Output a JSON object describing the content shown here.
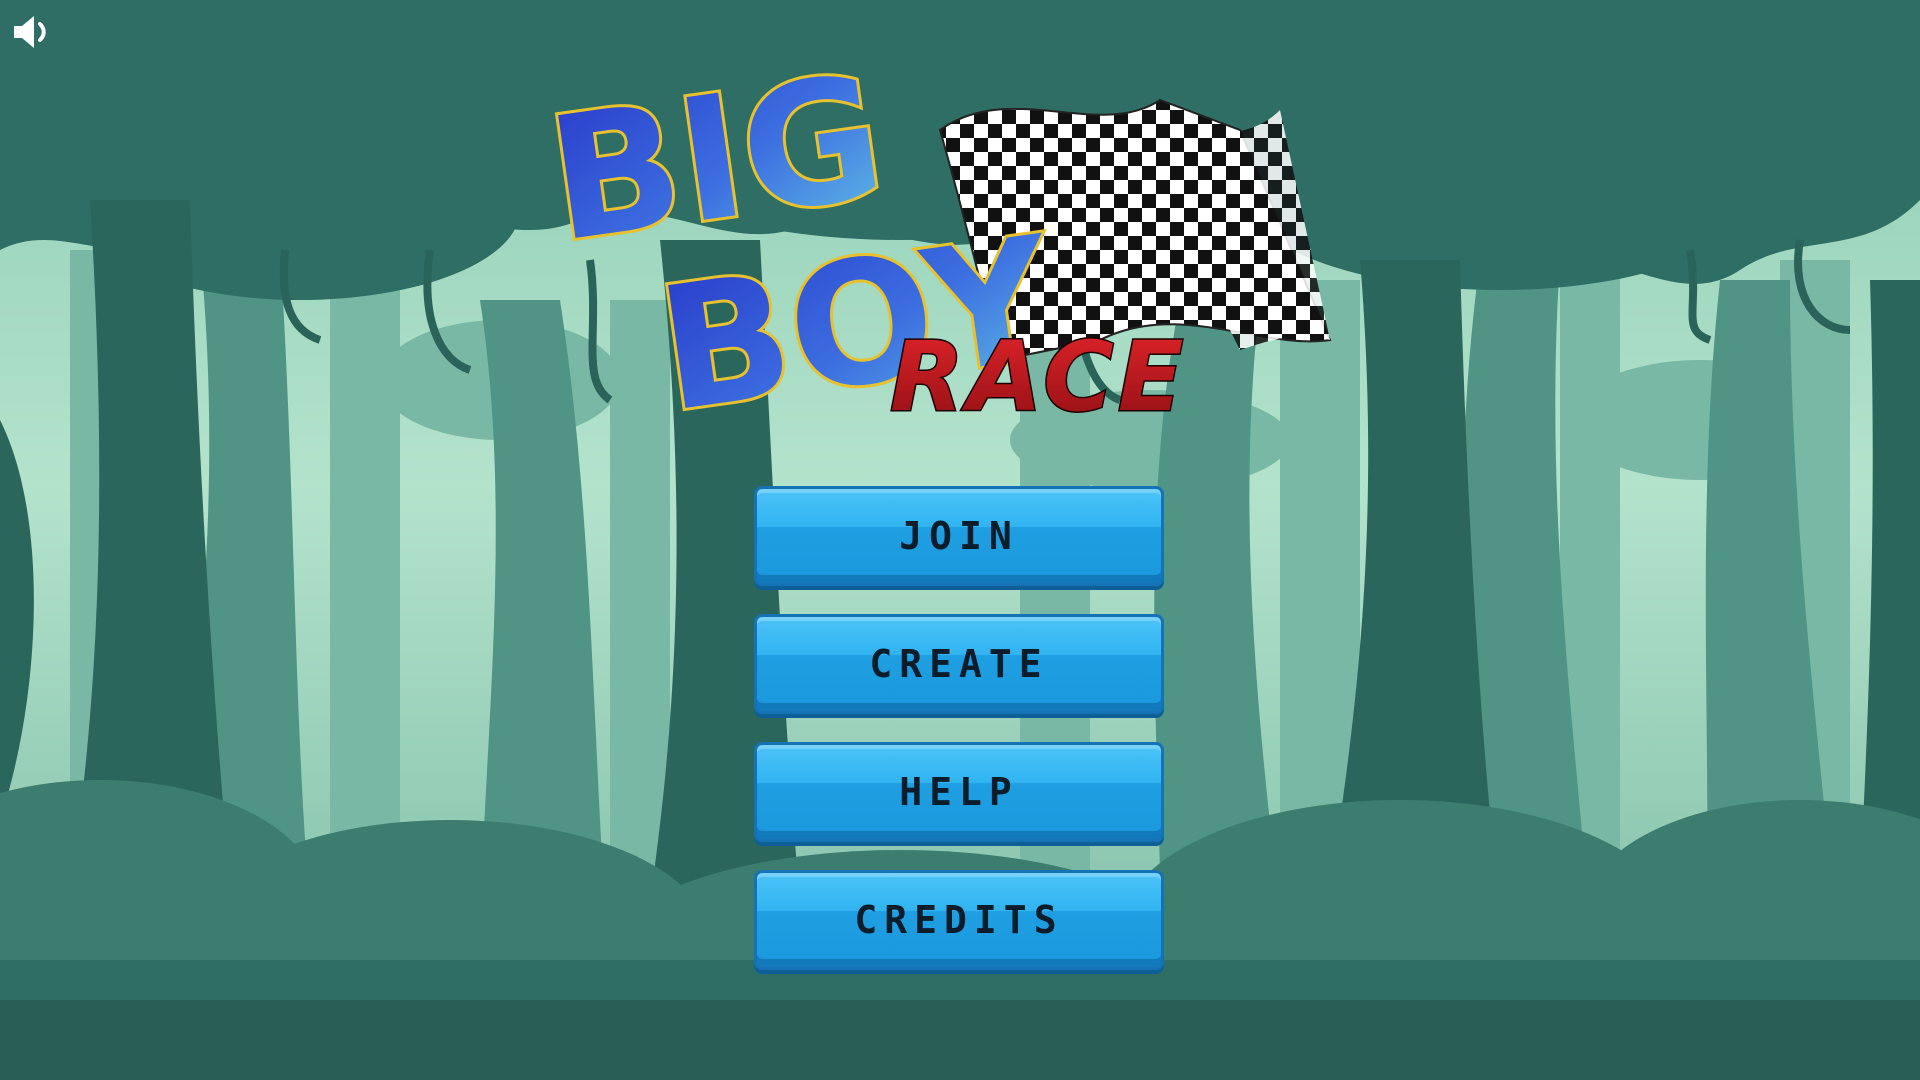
{
  "game": {
    "logo": {
      "word1": "BIG",
      "word2": "BOY",
      "word3": "RACE"
    },
    "sound": {
      "icon": "speaker-icon"
    },
    "menu": [
      {
        "label": "JOIN",
        "name": "join-button"
      },
      {
        "label": "CREATE",
        "name": "create-button"
      },
      {
        "label": "HELP",
        "name": "help-button"
      },
      {
        "label": "CREDITS",
        "name": "credits-button"
      }
    ],
    "colors": {
      "sky": "#a9dcc6",
      "forest_dark": "#2f6e64",
      "button": "#2cb0f0",
      "button_text": "#0b1d2b",
      "logo_blue": "#2b3fbf",
      "logo_outline": "#e7c12e",
      "race_red": "#c8191d"
    }
  }
}
